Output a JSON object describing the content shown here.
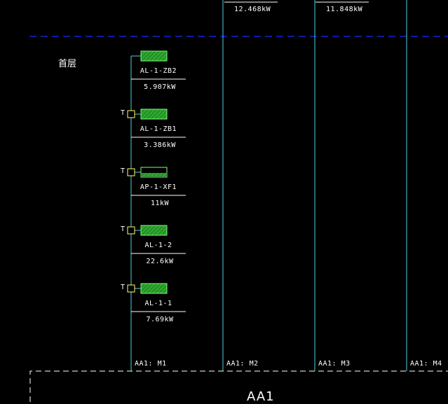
{
  "floor_label": "首层",
  "top_loads": [
    "12.468kW",
    "11.848kW"
  ],
  "breakers": [
    {
      "name": "AL-1-ZB2",
      "power": "5.907kW",
      "has_t": false,
      "fill": "hatched"
    },
    {
      "name": "AL-1-ZB1",
      "power": "3.386kW",
      "has_t": true,
      "fill": "hatched"
    },
    {
      "name": "AP-1-XF1",
      "power": "11kW",
      "has_t": true,
      "fill": "outline"
    },
    {
      "name": "AL-1-2",
      "power": "22.6kW",
      "has_t": true,
      "fill": "hatched"
    },
    {
      "name": "AL-1-1",
      "power": "7.69kW",
      "has_t": true,
      "fill": "hatched"
    }
  ],
  "t_mark": "T",
  "feeders": [
    "AA1: M1",
    "AA1: M2",
    "AA1: M3",
    "AA1: M4"
  ],
  "panel_label": "AA1",
  "colors": {
    "background": "#000000",
    "wire": "#4fd0e0",
    "breaker_fill": "#2ea82e",
    "breaker_edge": "#7cff7c",
    "dash_line": "#1a2bff",
    "text": "#ffffff"
  }
}
